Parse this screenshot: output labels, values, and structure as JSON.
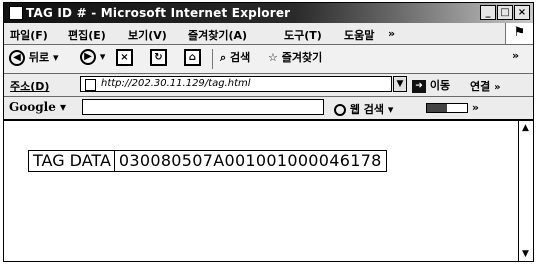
{
  "window": {
    "title": "TAG ID # - Microsoft Internet Explorer",
    "buttons": {
      "minimize": "_",
      "maximize": "□",
      "close": "×"
    }
  },
  "menubar": {
    "items": [
      "파일(F)",
      "편집(E)",
      "보기(V)",
      "즐겨찾기(A)",
      "도구(T)",
      "도움말"
    ],
    "overflow": "»"
  },
  "toolbar": {
    "back_label": "뒤로",
    "search_label": "검색",
    "favorites_label": "즐겨찾기",
    "overflow": "»"
  },
  "addressbar": {
    "label": "주소(D)",
    "url": "http://202.30.11.129/tag.html",
    "go_label": "이동",
    "links_label": "연결",
    "overflow": "»"
  },
  "googlebar": {
    "logo": "Google",
    "search_value": "",
    "search_label": "웹 검색",
    "pagerank_label": "PageRank",
    "overflow": "»"
  },
  "content": {
    "tag_label": "TAG DATA",
    "tag_value": "030080507A001001000046178"
  }
}
